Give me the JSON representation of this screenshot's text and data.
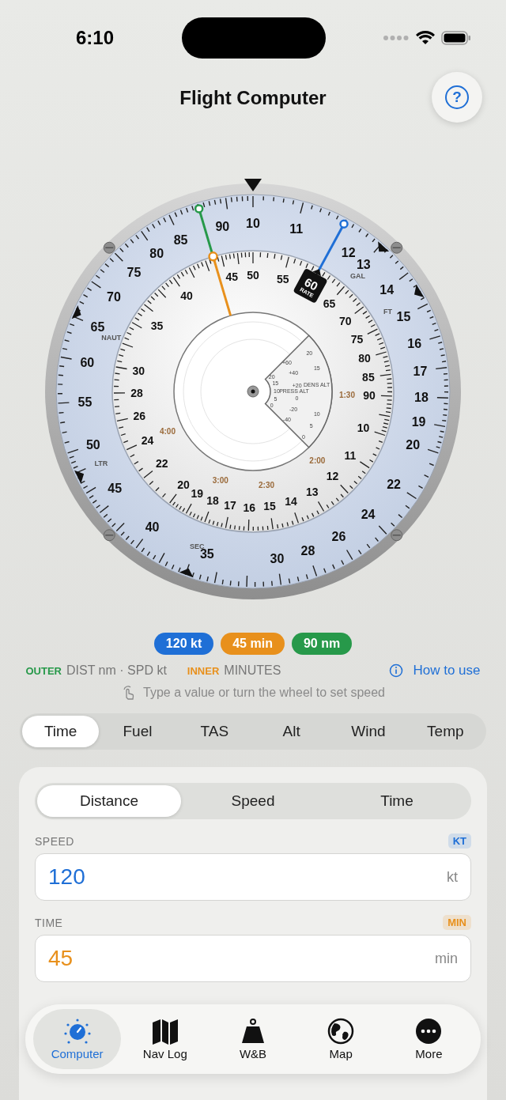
{
  "status_bar": {
    "time": "6:10"
  },
  "header": {
    "title": "Flight Computer",
    "help_icon": "?"
  },
  "dial": {
    "outer_scale": [
      "10",
      "11",
      "12",
      "13",
      "14",
      "15",
      "16",
      "17",
      "18",
      "19",
      "20",
      "22",
      "24",
      "26",
      "28",
      "30",
      "35",
      "40",
      "45",
      "50",
      "55",
      "60",
      "65",
      "70",
      "75",
      "80",
      "85",
      "90"
    ],
    "inner_scale": [
      "10",
      "11",
      "12",
      "20",
      "19",
      "18",
      "17",
      "16",
      "15",
      "14",
      "13",
      "40",
      "35",
      "30",
      "28",
      "26",
      "24",
      "22",
      "45",
      "50",
      "55",
      "65",
      "70",
      "75",
      "80",
      "85",
      "90"
    ],
    "time_marks": [
      "1:30",
      "2:00",
      "2:30",
      "3:00",
      "4:00"
    ],
    "unit_labels": [
      "NAUT",
      "GAL",
      "FT",
      "LTR",
      "SEC"
    ],
    "rate_marker": {
      "value": "60",
      "label": "RATE"
    },
    "density_window": {
      "press_alt_label": "PRESS ALT",
      "dens_alt_label": "DENS ALT",
      "pressure_altitudes": [
        "20",
        "15",
        "10",
        "5",
        "0"
      ],
      "temperatures": [
        "+60",
        "+40",
        "+20",
        "0",
        "-20",
        "-40"
      ],
      "density_altitudes": [
        "20",
        "15",
        "10",
        "5",
        "0"
      ]
    }
  },
  "readouts": [
    {
      "kind": "speed",
      "text": "120 kt",
      "color": "#1f6fd6"
    },
    {
      "kind": "time",
      "text": "45 min",
      "color": "#e8901c"
    },
    {
      "kind": "distance",
      "text": "90 nm",
      "color": "#27994a"
    }
  ],
  "legend": {
    "outer_tag": "OUTER",
    "outer_text": "DIST nm · SPD kt",
    "inner_tag": "INNER",
    "inner_text": "MINUTES",
    "link": "How to use"
  },
  "hint": "Type a value or turn the wheel to set speed",
  "mode_tabs": [
    {
      "label": "Time",
      "selected": true
    },
    {
      "label": "Fuel",
      "selected": false
    },
    {
      "label": "TAS",
      "selected": false
    },
    {
      "label": "Alt",
      "selected": false
    },
    {
      "label": "Wind",
      "selected": false
    },
    {
      "label": "Temp",
      "selected": false
    }
  ],
  "solve_tabs": [
    {
      "label": "Distance",
      "selected": true
    },
    {
      "label": "Speed",
      "selected": false
    },
    {
      "label": "Time",
      "selected": false
    }
  ],
  "fields": [
    {
      "label": "SPEED",
      "badge": "KT",
      "value": "120",
      "unit": "kt",
      "color": "#1f6fd6"
    },
    {
      "label": "TIME",
      "badge": "MIN",
      "value": "45",
      "unit": "min",
      "color": "#e8901c"
    }
  ],
  "tab_bar": [
    {
      "kind": "computer",
      "label": "Computer",
      "selected": true
    },
    {
      "kind": "navlog",
      "label": "Nav Log",
      "selected": false
    },
    {
      "kind": "wb",
      "label": "W&B",
      "selected": false
    },
    {
      "kind": "map",
      "label": "Map",
      "selected": false
    },
    {
      "kind": "more",
      "label": "More",
      "selected": false
    }
  ]
}
